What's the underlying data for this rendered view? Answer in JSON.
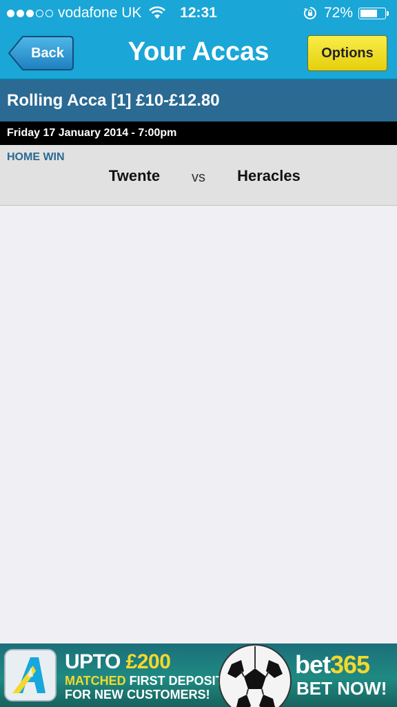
{
  "status_bar": {
    "carrier": "vodafone UK",
    "time": "12:31",
    "battery": "72%",
    "battery_level": 0.72
  },
  "nav": {
    "back_label": "Back",
    "title": "Your Accas",
    "options_label": "Options"
  },
  "acca": {
    "title": "Rolling Acca [1] £10-£12.80",
    "date": "Friday 17 January 2014 - 7:00pm",
    "bet_type": "HOME WIN",
    "home_team": "Twente",
    "vs": "vs",
    "away_team": "Heracles"
  },
  "ad": {
    "line1_a": "UPTO",
    "line1_b": "£200",
    "line2_a": "MATCHED",
    "line2_b": "FIRST DEPOSIT",
    "line3": "FOR NEW CUSTOMERS!",
    "brand_a": "bet",
    "brand_b": "365",
    "cta": "BET NOW!"
  },
  "colors": {
    "nav_blue": "#1aa6d6",
    "header_blue": "#2a6a93",
    "options_yellow": "#f2e22a"
  }
}
